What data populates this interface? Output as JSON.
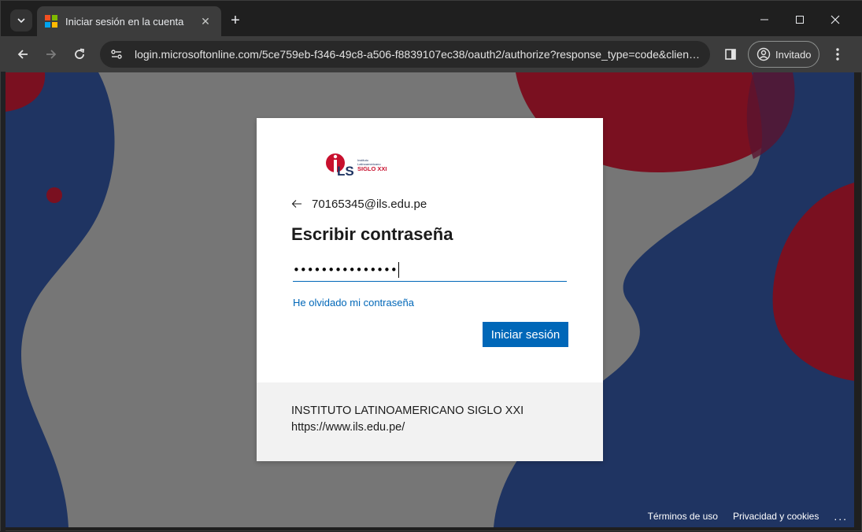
{
  "browser": {
    "tab": {
      "title": "Iniciar sesión en la cuenta"
    },
    "url": "login.microsoftonline.com/5ce759eb-f346-49c8-a506-f8839107ec38/oauth2/authorize?response_type=code&clien…",
    "profile_label": "Invitado",
    "favicon_colors": [
      "#f25022",
      "#7fba00",
      "#00a4ef",
      "#ffb900"
    ]
  },
  "login": {
    "logo_text": "iLS",
    "logo_subtitle": "SIGLO XXI",
    "identity": "70165345@ils.edu.pe",
    "heading": "Escribir contraseña",
    "password_masked": "•••••••••••••••",
    "forgot_link": "He olvidado mi contraseña",
    "submit_label": "Iniciar sesión"
  },
  "organization": {
    "name": "INSTITUTO LATINOAMERICANO SIGLO XXI",
    "url": "https://www.ils.edu.pe/"
  },
  "footer": {
    "terms": "Términos de uso",
    "privacy": "Privacidad y cookies",
    "more": "..."
  },
  "colors": {
    "accent": "#0067b8",
    "navy": "#1f3462",
    "crimson": "#7a1020",
    "background_gray": "#767676"
  }
}
